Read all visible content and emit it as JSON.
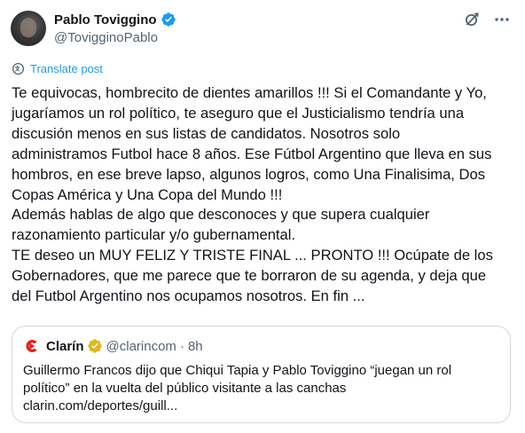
{
  "author": {
    "display_name": "Pablo Toviggino",
    "handle": "@TovigginoPablo",
    "verified_icon": "verified-badge-icon",
    "avatar_icon": "avatar"
  },
  "actions": {
    "grok_icon": "grok-icon",
    "more_icon": "more-icon"
  },
  "translate": {
    "label": "Translate post",
    "icon": "translate-icon"
  },
  "tweet": {
    "lines": [
      "Te equivocas, hombrecito de dientes amarillos !!! Si el Comandante y Yo,",
      "jugaríamos un rol político, te aseguro que el Justicialismo tendría una",
      "discusión menos en sus listas de candidatos. Nosotros solo",
      "administramos Futbol hace 8 años. Ese Fútbol Argentino que lleva en sus",
      "hombros, en ese breve lapso, algunos logros, como Una Finalisima, Dos",
      "Copas América y Una Copa del Mundo !!!",
      "Además hablas de algo que desconoces y que supera cualquier",
      "razonamiento particular y/o gubernamental.",
      "TE deseo un MUY FELIZ Y TRISTE FINAL ... PRONTO !!! Ocúpate de los",
      "Gobernadores, que me parece que te borraron de su agenda, y deja que",
      "del Futbol Argentino nos ocupamos nosotros. En fin ..."
    ]
  },
  "quote": {
    "name": "Clarín",
    "handle": "@clarincom",
    "separator": "·",
    "time": "8h",
    "lines": [
      "Guillermo Francos dijo que Chiqui Tapia y Pablo Toviggino “juegan un rol",
      "político” en la vuelta del público visitante a las canchas",
      "clarin.com/deportes/guill..."
    ]
  },
  "colors": {
    "accent": "#1d9bf0",
    "text": "#0f1419",
    "secondary": "#536471",
    "border": "#cfd9de",
    "clarin_red": "#e2231a"
  }
}
